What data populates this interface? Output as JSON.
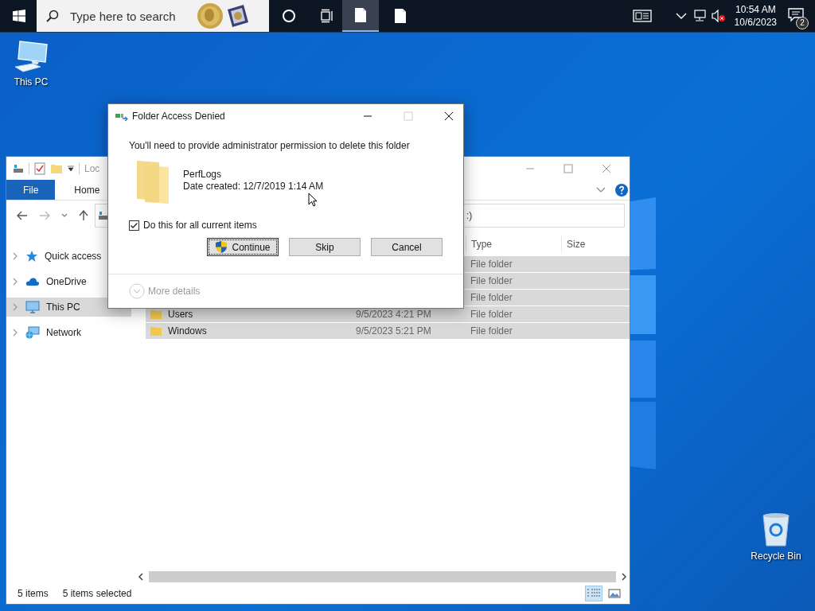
{
  "taskbar": {
    "search": {
      "placeholder": "Type here to search"
    },
    "apps": [
      {
        "selected": true
      },
      {
        "selected": false
      }
    ],
    "volume": {
      "muted": true
    },
    "clock": {
      "time": "10:54 AM",
      "date": "10/6/2023"
    },
    "notifications": {
      "count": "2"
    }
  },
  "desktop_icons": [
    {
      "label": "This PC",
      "kind": "pc"
    },
    {
      "label": "Recycle Bin",
      "kind": "bin"
    }
  ],
  "explorer": {
    "title": "Loc",
    "ribbon_tabs": [
      {
        "label": "File",
        "kind": "menu"
      },
      {
        "label": "Home",
        "kind": "tab"
      }
    ],
    "address": ":)",
    "sidebar": [
      {
        "label": "Quick access",
        "kind": "star",
        "selected": false
      },
      {
        "label": "OneDrive",
        "kind": "cloud",
        "selected": false
      },
      {
        "label": "This PC",
        "kind": "pc",
        "selected": true
      },
      {
        "label": "Network",
        "kind": "network",
        "selected": false
      }
    ],
    "columns": [
      "Type",
      "Size"
    ],
    "rows": [
      {
        "type": "File folder",
        "selected": true
      },
      {
        "type": "File folder",
        "selected": true
      },
      {
        "type": "File folder",
        "selected": true
      },
      {
        "name": "Users",
        "date": "9/5/2023 4:21 PM",
        "type": "File folder",
        "selected": true
      },
      {
        "name": "Windows",
        "date": "9/5/2023 5:21 PM",
        "type": "File folder",
        "selected": true
      }
    ],
    "status": {
      "count": "5 items",
      "selection": "5 items selected"
    },
    "views": [
      {
        "kind": "details",
        "selected": true
      },
      {
        "kind": "tiles",
        "selected": false
      }
    ]
  },
  "dialog": {
    "title": "Folder Access Denied",
    "message": "You'll need to provide administrator permission to delete this folder",
    "item": {
      "name": "PerfLogs",
      "date": "Date created: 12/7/2019 1:14 AM"
    },
    "apply_all": {
      "label": "Do this for all current items",
      "checked": true
    },
    "buttons": [
      {
        "label": "Continue",
        "kind": "elevated",
        "focused": true
      },
      {
        "label": "Skip",
        "kind": "plain",
        "focused": false
      },
      {
        "label": "Cancel",
        "kind": "plain",
        "focused": false
      }
    ],
    "more_details": {
      "label": "More details",
      "disabled": true
    }
  }
}
